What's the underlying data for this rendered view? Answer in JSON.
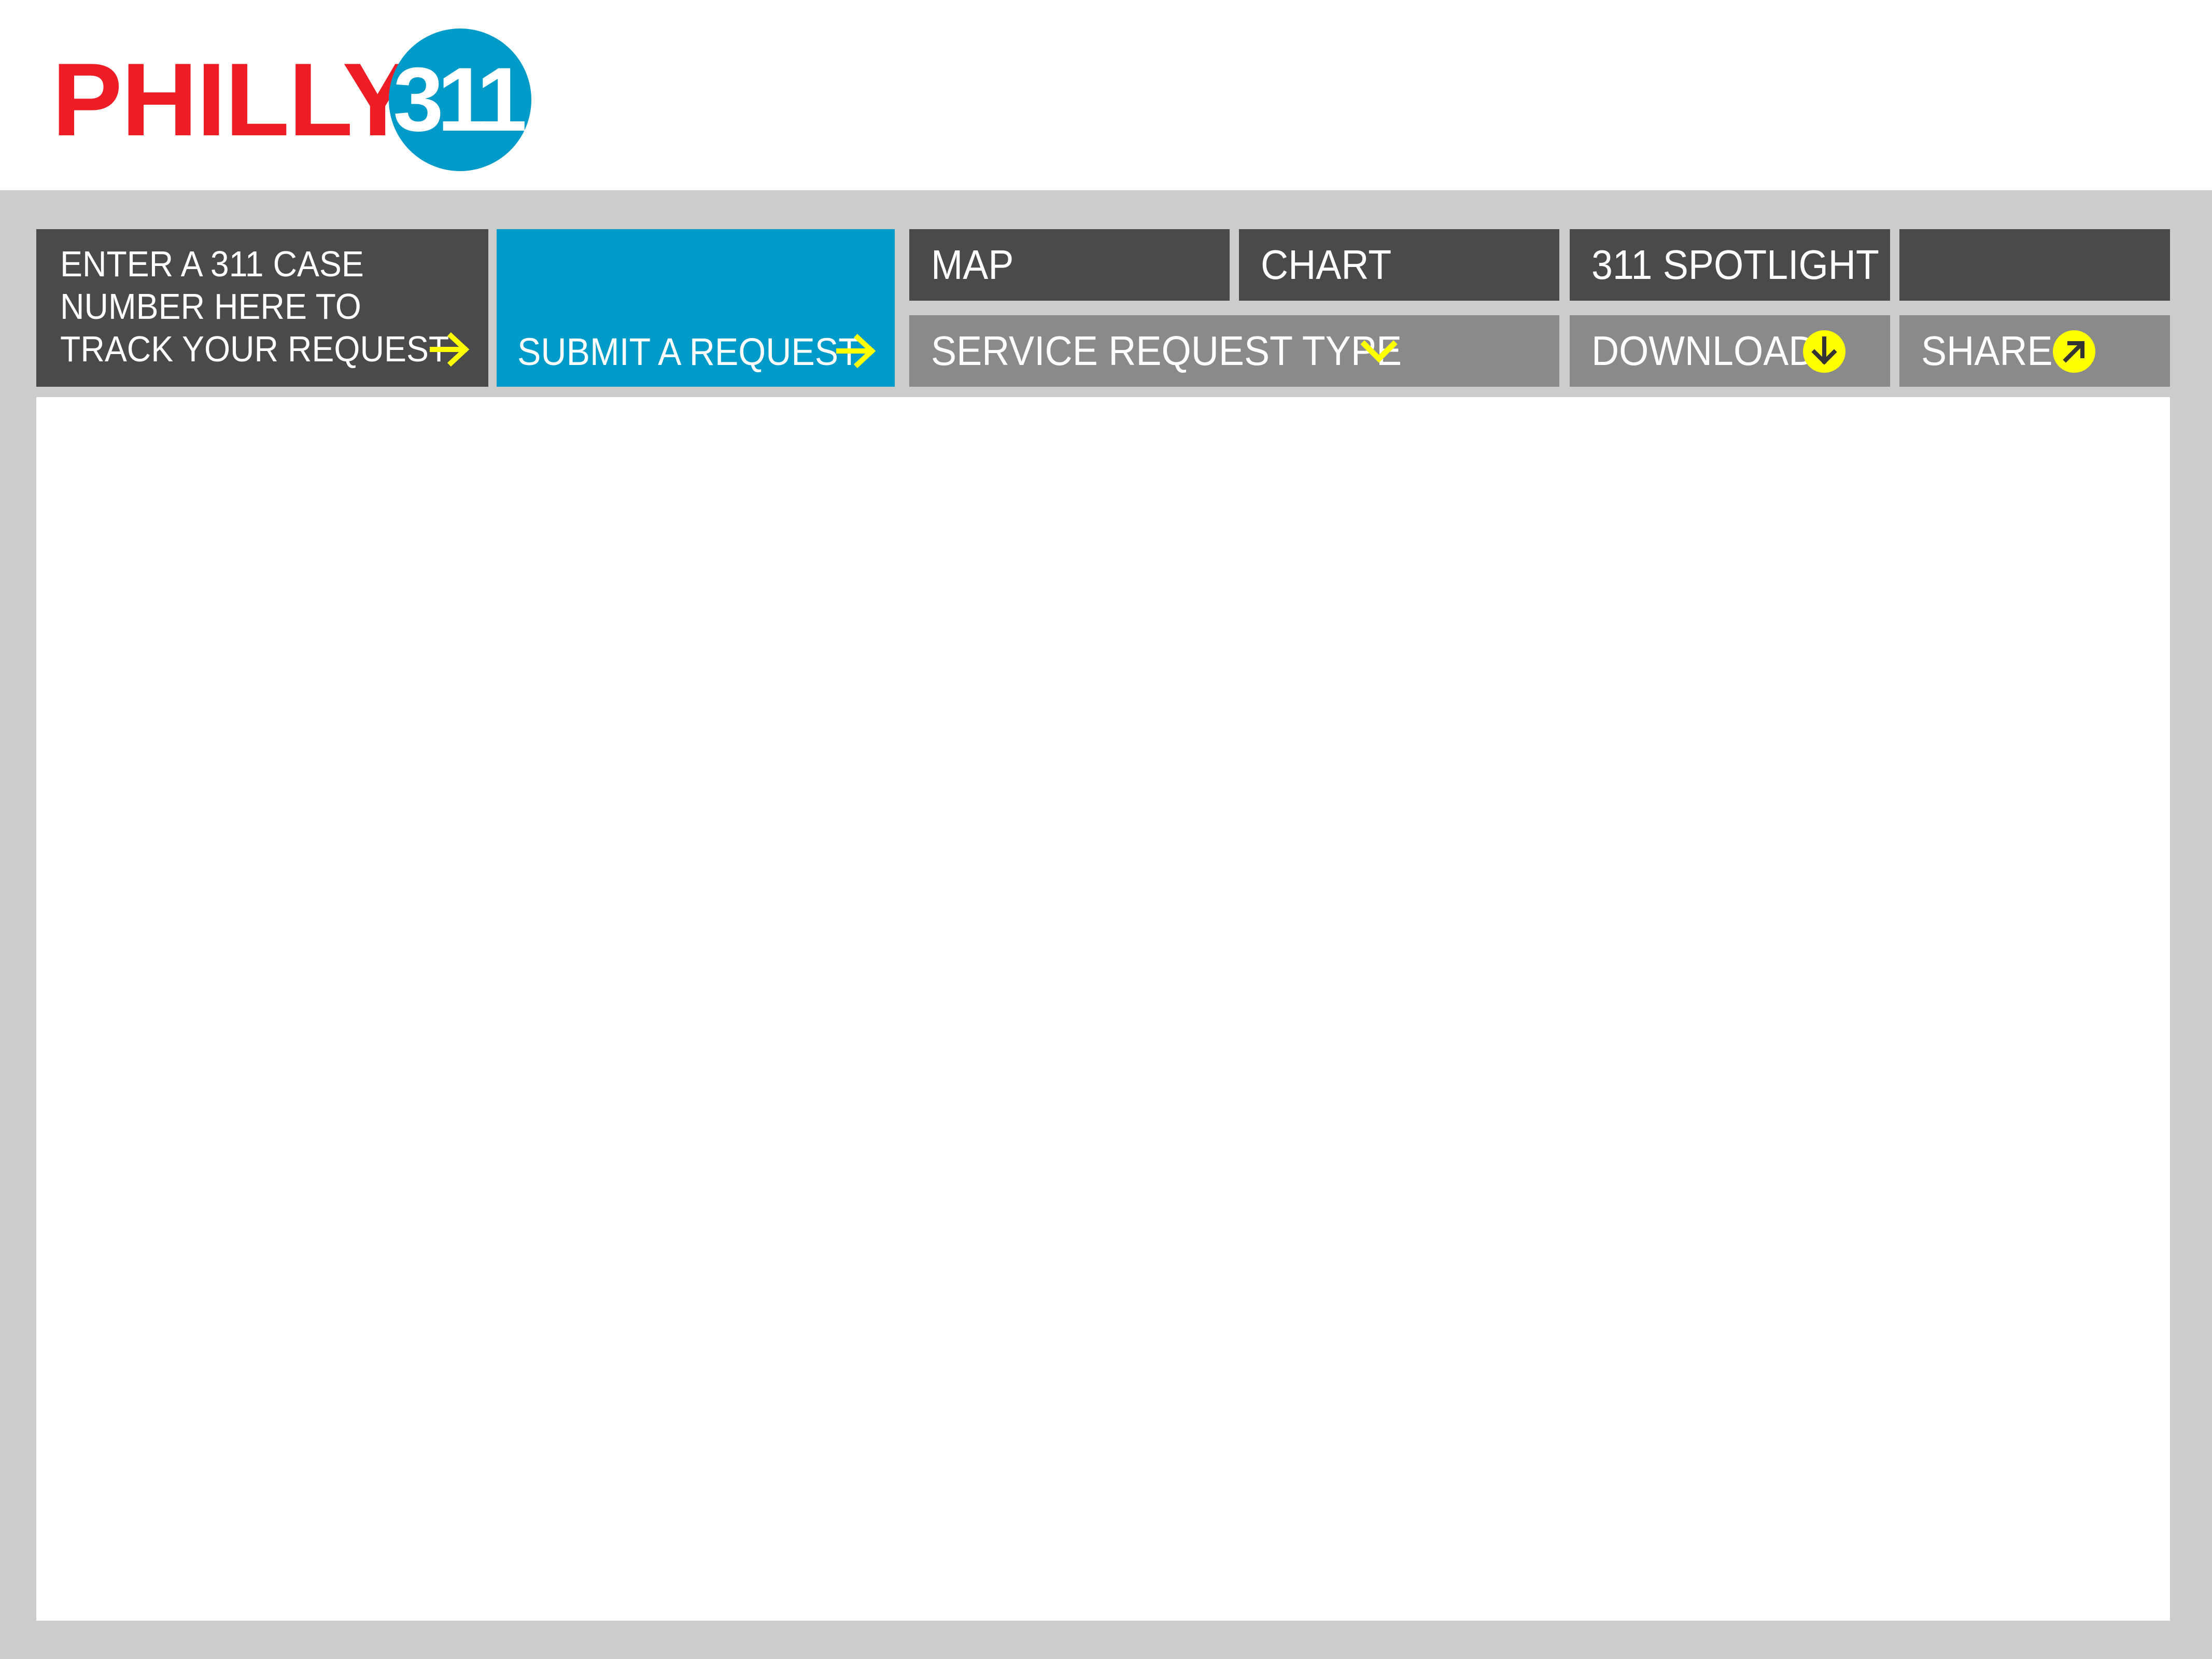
{
  "header": {
    "logo_text": "PHILLY",
    "logo_number": "311",
    "logo_colors": {
      "text": "#ee1c25",
      "circle": "#009bc8"
    }
  },
  "nav": {
    "case_lookup": {
      "line1": "ENTER A 311 CASE",
      "line2": "NUMBER HERE TO",
      "line3": "TRACK YOUR REQUEST",
      "icon": "arrow-right-icon"
    },
    "submit": {
      "label": "SUBMIT A REQUEST",
      "icon": "arrow-right-icon"
    },
    "tabs": [
      {
        "label": "MAP"
      },
      {
        "label": "CHART"
      },
      {
        "label": "311 SPOTLIGHT"
      }
    ],
    "filters": {
      "service_request_type": "SERVICE REQUEST TYPE",
      "service_request_icon": "chevron-down-icon"
    },
    "actions": {
      "download": "DOWNLOAD",
      "download_icon": "download-icon",
      "share": "SHARE",
      "share_icon": "share-icon"
    }
  },
  "colors": {
    "frame": "#cccccc",
    "dark_tile": "#4a4a4a",
    "mid_tile": "#8a8a8a",
    "accent_blue": "#009bc8",
    "accent_yellow": "#ffff00"
  }
}
